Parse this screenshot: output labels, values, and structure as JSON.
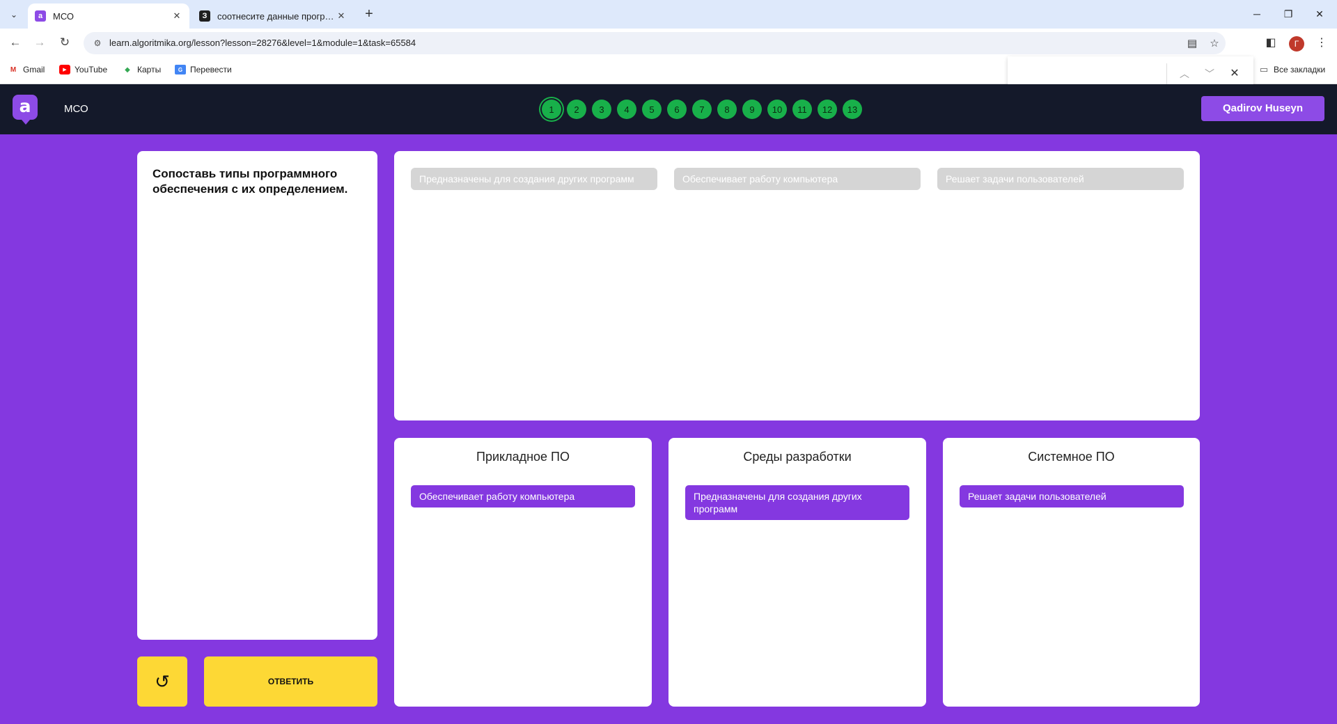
{
  "browser": {
    "tabs": [
      {
        "title": "МСО",
        "active": true,
        "favicon": "algoritmika-icon"
      },
      {
        "title": "соотнесите данные программ",
        "active": false,
        "favicon": "znanija-icon"
      }
    ],
    "url": "learn.algoritmika.org/lesson?lesson=28276&level=1&module=1&task=65584",
    "profile_initial": "Г",
    "bookmarks": [
      "Gmail",
      "YouTube",
      "Карты",
      "Перевести"
    ],
    "all_bookmarks": "Все закладки",
    "find_value": ""
  },
  "app": {
    "logo": "a",
    "title": "МСО",
    "steps": [
      "1",
      "2",
      "3",
      "4",
      "5",
      "6",
      "7",
      "8",
      "9",
      "10",
      "11",
      "12",
      "13"
    ],
    "current_step": "1",
    "user": "Qadirov Huseyn"
  },
  "task": {
    "question": "Сопоставь типы программного обеспечения с их определением.",
    "answer_label": "ОТВЕТИТЬ",
    "source_items": [
      "Предназначены для создания других программ",
      "Обеспечивает работу компьютера",
      "Решает задачи пользователей"
    ],
    "zones": [
      {
        "title": "Прикладное ПО",
        "item": "Обеспечивает работу компьютера"
      },
      {
        "title": "Среды разработки",
        "item": "Предназначены для создания других программ"
      },
      {
        "title": "Системное ПО",
        "item": "Решает задачи пользователей"
      }
    ]
  },
  "colors": {
    "page_bg": "#8438e0",
    "header_bg": "#14192a",
    "step_green": "#18b04a",
    "button_yellow": "#fdd835",
    "chip_purple": "#8438e0",
    "chip_ghost": "#d5d5d5"
  }
}
